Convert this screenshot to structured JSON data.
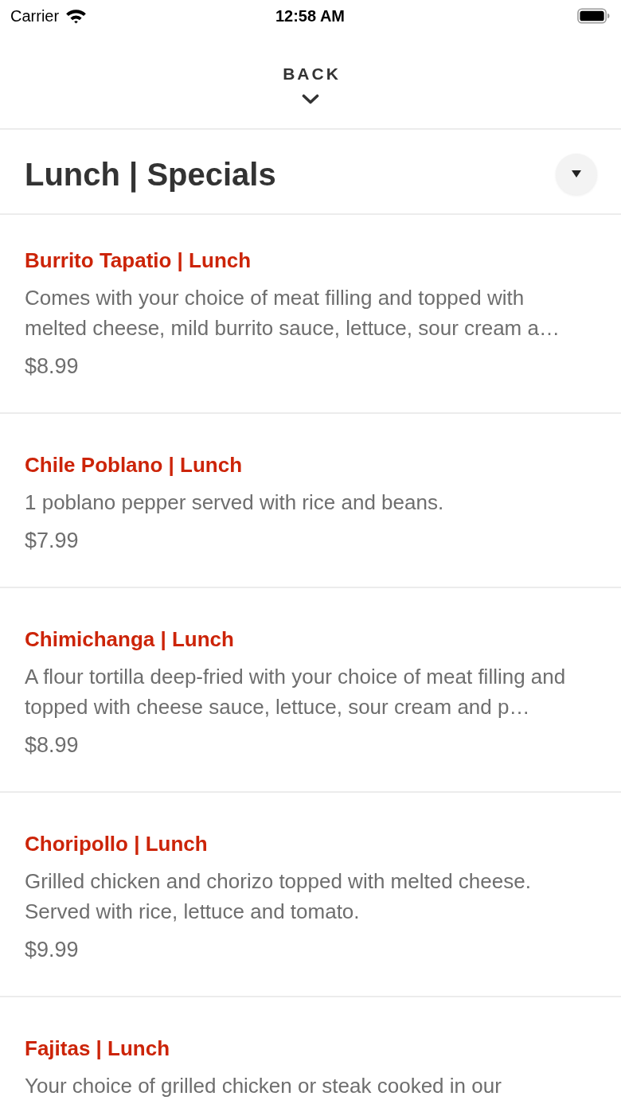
{
  "status_bar": {
    "carrier": "Carrier",
    "time": "12:58 AM"
  },
  "back": {
    "label": "BACK"
  },
  "section": {
    "title": "Lunch | Specials"
  },
  "items": [
    {
      "name": "Burrito Tapatio | Lunch",
      "description": "Comes with your choice of meat filling and topped with melted cheese, mild burrito sauce, lettuce, sour cream a…",
      "price": "$8.99"
    },
    {
      "name": "Chile Poblano | Lunch",
      "description": "1 poblano pepper served with rice and beans.",
      "price": "$7.99"
    },
    {
      "name": "Chimichanga | Lunch",
      "description": "A flour tortilla deep-fried with your choice of meat filling and topped with cheese sauce, lettuce, sour cream and p…",
      "price": "$8.99"
    },
    {
      "name": "Choripollo | Lunch",
      "description": "Grilled chicken and chorizo topped with melted cheese. Served with rice, lettuce and tomato.",
      "price": "$9.99"
    },
    {
      "name": "Fajitas | Lunch",
      "description": "Your choice of grilled chicken or steak cooked in our"
    }
  ]
}
